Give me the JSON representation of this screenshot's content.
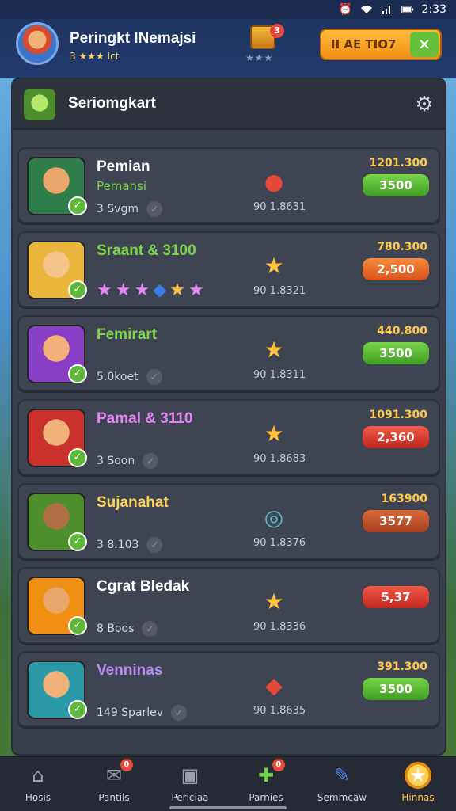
{
  "status_bar": {
    "time": "2:33"
  },
  "header": {
    "title": "Peringkt INemajsi",
    "subtitle": "3 ★★★ Ict",
    "chest_badge": "3",
    "chest_stars": "★★★",
    "button_label": "II  AE TIO7",
    "button_check": "✕"
  },
  "panel": {
    "title": "Seriomgkart"
  },
  "rows": [
    {
      "name": "Pemian",
      "tag": "Pemansi",
      "sub": "3 Svgm",
      "stat": "90 1.8631",
      "score": "1201.300",
      "pill": "3500",
      "pill_style": "green",
      "icon": "red-gem-icon",
      "name_color": "#ffffff"
    },
    {
      "name": "Sraant & 3100",
      "stars": "★★★◆★★",
      "stat": "90 1.8321",
      "score": "780.300",
      "pill": "2,500",
      "pill_style": "orange",
      "icon": "star-icon",
      "name_color": "#7cd64a"
    },
    {
      "name": "Femirart",
      "sub": "5.0koet",
      "stat": "90 1.8311",
      "score": "440.800",
      "pill": "3500",
      "pill_style": "green",
      "icon": "star-icon",
      "name_color": "#7cd64a"
    },
    {
      "name": "Pamal & 3110",
      "sub": "3 Soon",
      "stat": "90 1.8683",
      "score": "1091.300",
      "pill": "2,360",
      "pill_style": "red",
      "icon": "star-icon",
      "name_color": "#e784f5"
    },
    {
      "name": "Sujanahat",
      "sub": "3 8.103",
      "stat": "90 1.8376",
      "score": "163900",
      "pill": "3577",
      "pill_style": "rust",
      "icon": "compass-icon",
      "name_color": "#ffd35a"
    },
    {
      "name": "Cgrat Bledak",
      "sub": "8 Boos",
      "stat": "90 1.8336",
      "score": "",
      "pill": "5,37",
      "pill_style": "red",
      "icon": "star-icon",
      "name_color": "#ffffff"
    },
    {
      "name": "Venninas",
      "sub": "149 Sparlev",
      "stat": "90 1.8635",
      "score": "391.300",
      "pill": "3500",
      "pill_style": "green",
      "icon": "gem-cluster-icon",
      "name_color": "#b88cf5"
    }
  ],
  "nav": [
    {
      "label": "Hosis",
      "badge": ""
    },
    {
      "label": "Pantils",
      "badge": "0"
    },
    {
      "label": "Periciaa",
      "badge": ""
    },
    {
      "label": "Parnies",
      "badge": "0"
    },
    {
      "label": "Semmcaw",
      "badge": ""
    },
    {
      "label": "Hinnas",
      "badge": ""
    }
  ]
}
